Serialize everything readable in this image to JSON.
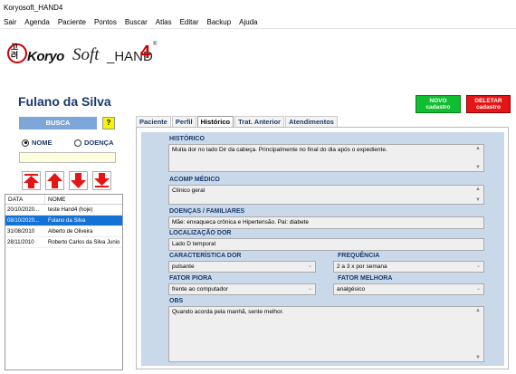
{
  "window": {
    "title": "Koryosoft_HAND4"
  },
  "menu": [
    "Sair",
    "Agenda",
    "Paciente",
    "Pontos",
    "Buscar",
    "Atlas",
    "Editar",
    "Backup",
    "Ajuda"
  ],
  "logo": {
    "hangul": "고려",
    "brand_bold": "Koryo",
    "brand_script": "Soft",
    "brand_suffix": "_HAND",
    "brand_number": "4",
    "registered": "®"
  },
  "patient": {
    "name": "Fulano da Silva"
  },
  "actions": {
    "new_line1": "NOVO",
    "new_line2": "cadastro",
    "delete_line1": "DELETAR",
    "delete_line2": "cadastro"
  },
  "search": {
    "button_label": "BUSCA",
    "help_label": "?",
    "radio_name": "NOME",
    "radio_disease": "DOENÇA",
    "selected": "NOME",
    "input_value": ""
  },
  "list": {
    "headers": [
      "DATA",
      "NOME"
    ],
    "rows": [
      {
        "date": "20/10/2020...",
        "name": "teste Hand4 (hoje)"
      },
      {
        "date": "08/10/2020...",
        "name": "Fulano da Silva"
      },
      {
        "date": "31/08/2010",
        "name": "Alberto de Oliveira"
      },
      {
        "date": "28/11/2010",
        "name": "Roberto Carlos da Silva Junio"
      }
    ],
    "selected_index": 1
  },
  "tabs": [
    "Paciente",
    "Perfil",
    "Histórico",
    "Trat. Anterior",
    "Atendimentos"
  ],
  "active_tab": "Histórico",
  "form": {
    "historico_label": "HISTÓRICO",
    "historico_value": "Muita dor no lado Dir da cabeça. Principalmente no final do dia após o expediente.",
    "acomp_label": "ACOMP MÉDICO",
    "acomp_value": "Clínico geral",
    "doencas_label": "DOENÇAS / FAMILIARES",
    "doencas_value": "Mãe: enxaqueca crônica e Hipertensão. Pai: diabete",
    "localizacao_label": "LOCALIZAÇÃO DOR",
    "localizacao_value": "Lado D temporal",
    "caracteristica_label": "CARACTERÍSTICA DOR",
    "caracteristica_value": "pulsante",
    "frequencia_label": "FREQUÊNCIA",
    "frequencia_value": "2 a 3 x por semana",
    "piora_label": "FATOR PIORA",
    "piora_value": "frente ao computador",
    "melhora_label": "FATOR MELHORA",
    "melhora_value": "analgésico",
    "obs_label": "OBS",
    "obs_value": "Quando acorda pela manhã, sente melhor."
  },
  "colors": {
    "new_button": "#0fbf2f",
    "delete_button": "#e61414",
    "search_button": "#7fa6d9",
    "panel_bg": "#c9d9ea",
    "selection": "#1472d6",
    "label_text": "#1a3a6b"
  }
}
